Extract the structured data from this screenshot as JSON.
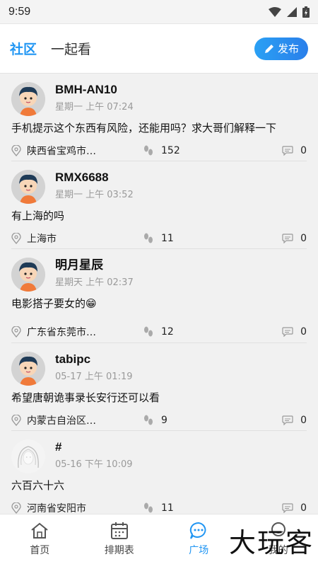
{
  "status": {
    "time": "9:59"
  },
  "header": {
    "tabs": [
      {
        "label": "社区",
        "active": true
      },
      {
        "label": "一起看",
        "active": false
      }
    ],
    "publish_label": "发布"
  },
  "posts": [
    {
      "author": "BMH-AN10",
      "time": "星期一 上午 07:24",
      "content": "手机提示这个东西有风险，还能用吗？求大哥们解释一下",
      "location": "陕西省宝鸡市…",
      "views": "152",
      "comments": "0",
      "avatar": "cartoon-boy"
    },
    {
      "author": "RMX6688",
      "time": "星期一 上午 03:52",
      "content": "有上海的吗",
      "location": "上海市",
      "views": "11",
      "comments": "0",
      "avatar": "cartoon-boy"
    },
    {
      "author": "明月星辰",
      "time": "星期天 上午 02:37",
      "content": "电影搭子要女的😁",
      "location": "广东省东莞市…",
      "views": "12",
      "comments": "0",
      "avatar": "cartoon-boy"
    },
    {
      "author": "tabipc",
      "time": "05-17 上午 01:19",
      "content": "希望唐朝诡事录长安行还可以看",
      "location": "内蒙古自治区…",
      "views": "9",
      "comments": "0",
      "avatar": "cartoon-boy"
    },
    {
      "author": "#",
      "time": "05-16 下午 10:09",
      "content": "六百六十六",
      "location": "河南省安阳市",
      "views": "11",
      "comments": "0",
      "avatar": "sketch-girl"
    }
  ],
  "nav": [
    {
      "label": "首页",
      "icon": "home-icon",
      "active": false
    },
    {
      "label": "排期表",
      "icon": "calendar-icon",
      "active": false
    },
    {
      "label": "广场",
      "icon": "chat-icon",
      "active": true
    },
    {
      "label": "我的",
      "icon": "user-icon",
      "active": false
    }
  ],
  "watermark": "大玩客",
  "colors": {
    "accent": "#2196f3",
    "feed_bg": "#f1f1f1"
  }
}
